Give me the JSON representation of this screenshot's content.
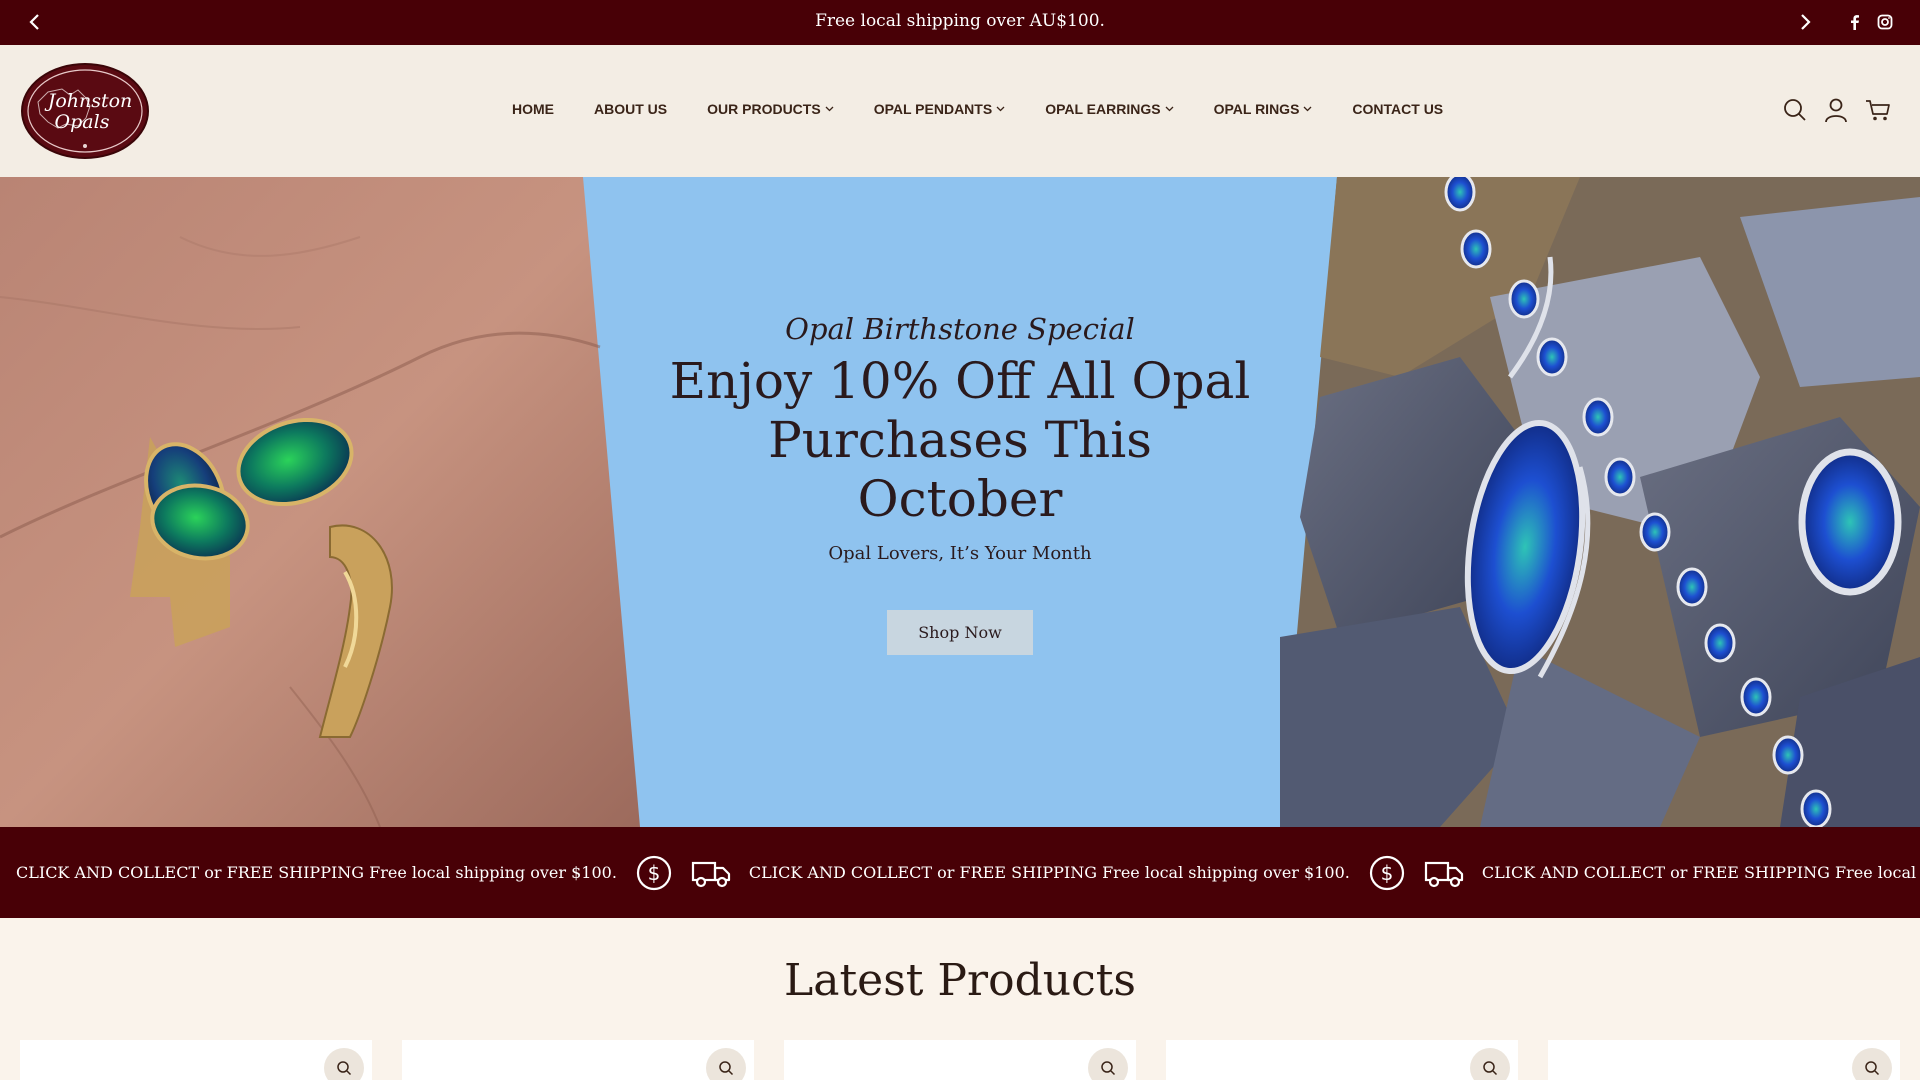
{
  "announcement": {
    "message": "Free local shipping over AU$100.",
    "prev_icon": "chevron-left-icon",
    "next_icon": "chevron-right-icon",
    "social": [
      "facebook-icon",
      "instagram-icon"
    ]
  },
  "header": {
    "logo_text_line1": "Johnston",
    "logo_text_line2": "Opals",
    "nav": [
      {
        "label": "HOME",
        "dropdown": false
      },
      {
        "label": "ABOUT US",
        "dropdown": false
      },
      {
        "label": "OUR PRODUCTS",
        "dropdown": true
      },
      {
        "label": "OPAL PENDANTS",
        "dropdown": true
      },
      {
        "label": "OPAL EARRINGS",
        "dropdown": true
      },
      {
        "label": "OPAL RINGS",
        "dropdown": true
      },
      {
        "label": "CONTACT US",
        "dropdown": false
      }
    ],
    "icons": [
      "search-icon",
      "account-icon",
      "cart-icon"
    ]
  },
  "hero": {
    "kicker": "Opal Birthstone Special",
    "headline": "Enjoy 10% Off All Opal Purchases This October",
    "subtitle": "Opal Lovers, It’s Your Month",
    "button_label": "Shop Now"
  },
  "marquee": {
    "text": "CLICK AND COLLECT or FREE SHIPPING Free local shipping over $100.",
    "icons": [
      "dollar-icon",
      "truck-icon"
    ]
  },
  "products": {
    "title": "Latest Products",
    "quick_view_icon": "search-icon"
  },
  "colors": {
    "brand_maroon": "#480006",
    "hero_blue": "#8fc3ef",
    "page_cream": "#faf3eb",
    "header_bg": "#f3ede4"
  }
}
